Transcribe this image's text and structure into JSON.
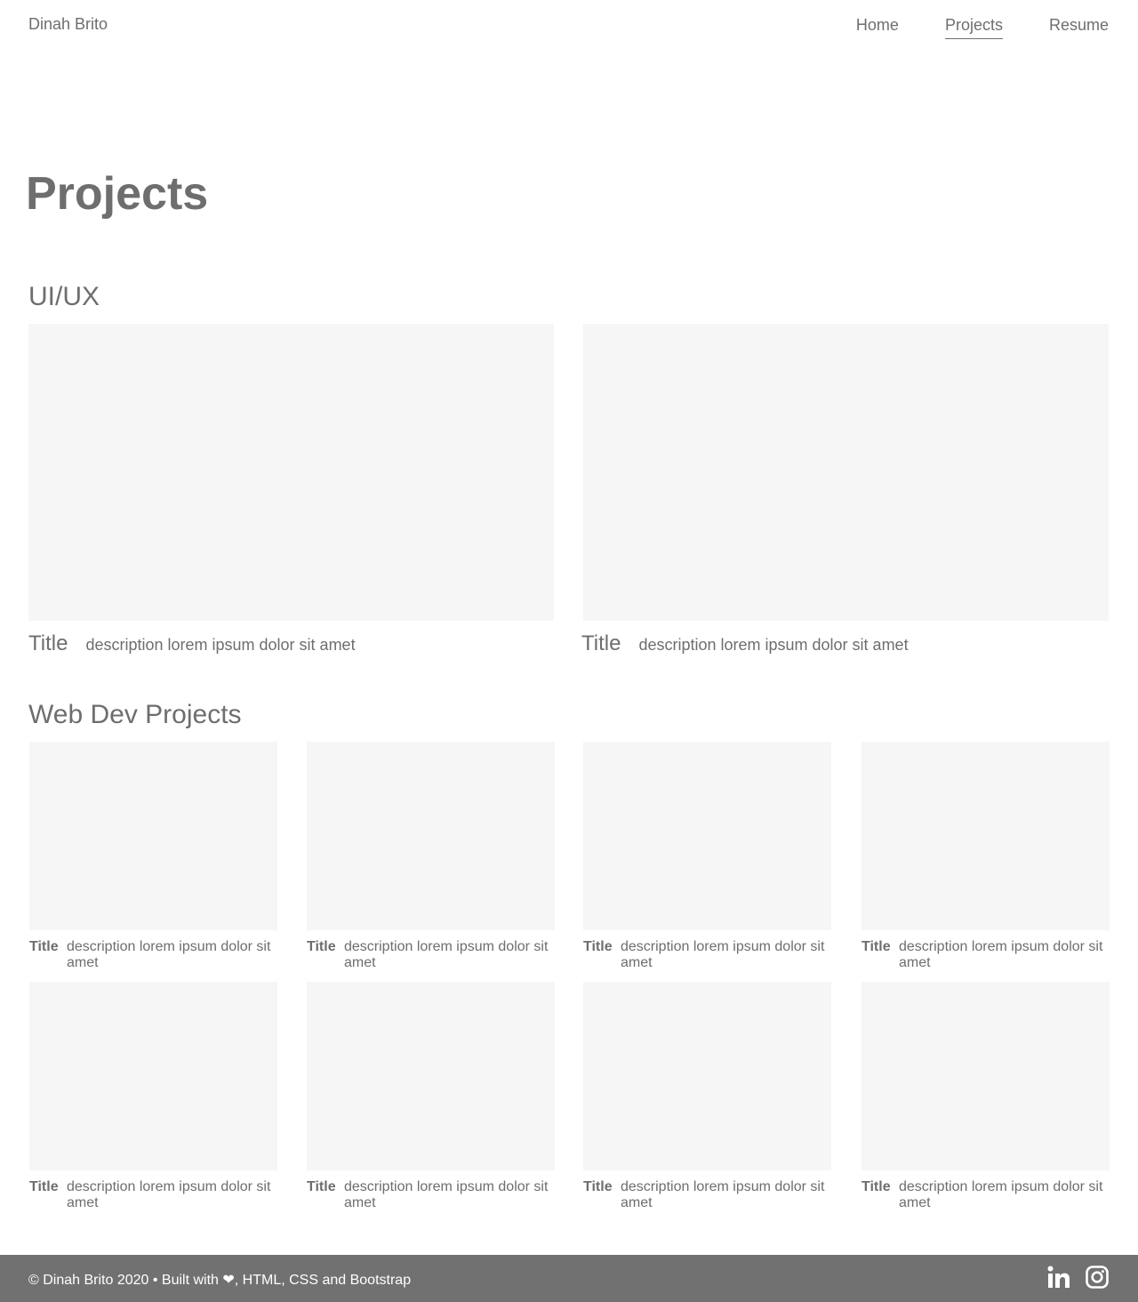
{
  "header": {
    "brand": "Dinah Brito",
    "nav": [
      {
        "label": "Home",
        "active": false
      },
      {
        "label": "Projects",
        "active": true
      },
      {
        "label": "Resume",
        "active": false
      }
    ]
  },
  "main": {
    "page_title": "Projects",
    "uiux": {
      "heading": "UI/UX",
      "cards": [
        {
          "title": "Title",
          "description": "description lorem ipsum dolor sit amet"
        },
        {
          "title": "Title",
          "description": "description lorem ipsum dolor sit amet"
        }
      ]
    },
    "webdev": {
      "heading": "Web Dev Projects",
      "cards": [
        {
          "title": "Title",
          "description": "description lorem ipsum dolor sit amet"
        },
        {
          "title": "Title",
          "description": "description lorem ipsum dolor sit amet"
        },
        {
          "title": "Title",
          "description": "description lorem ipsum dolor sit amet"
        },
        {
          "title": "Title",
          "description": "description lorem ipsum dolor sit amet"
        },
        {
          "title": "Title",
          "description": "description lorem ipsum dolor sit amet"
        },
        {
          "title": "Title",
          "description": "description lorem ipsum dolor sit amet"
        },
        {
          "title": "Title",
          "description": "description lorem ipsum dolor sit amet"
        },
        {
          "title": "Title",
          "description": "description lorem ipsum dolor sit amet"
        }
      ]
    }
  },
  "footer": {
    "text": "© Dinah Brito 2020 • Built with ❤, HTML, CSS and Bootstrap",
    "social": [
      "linkedin-icon",
      "instagram-icon"
    ]
  },
  "colors": {
    "text": "#6e6e6e",
    "placeholder": "#f6f6f6",
    "footer_bg": "#717171"
  }
}
